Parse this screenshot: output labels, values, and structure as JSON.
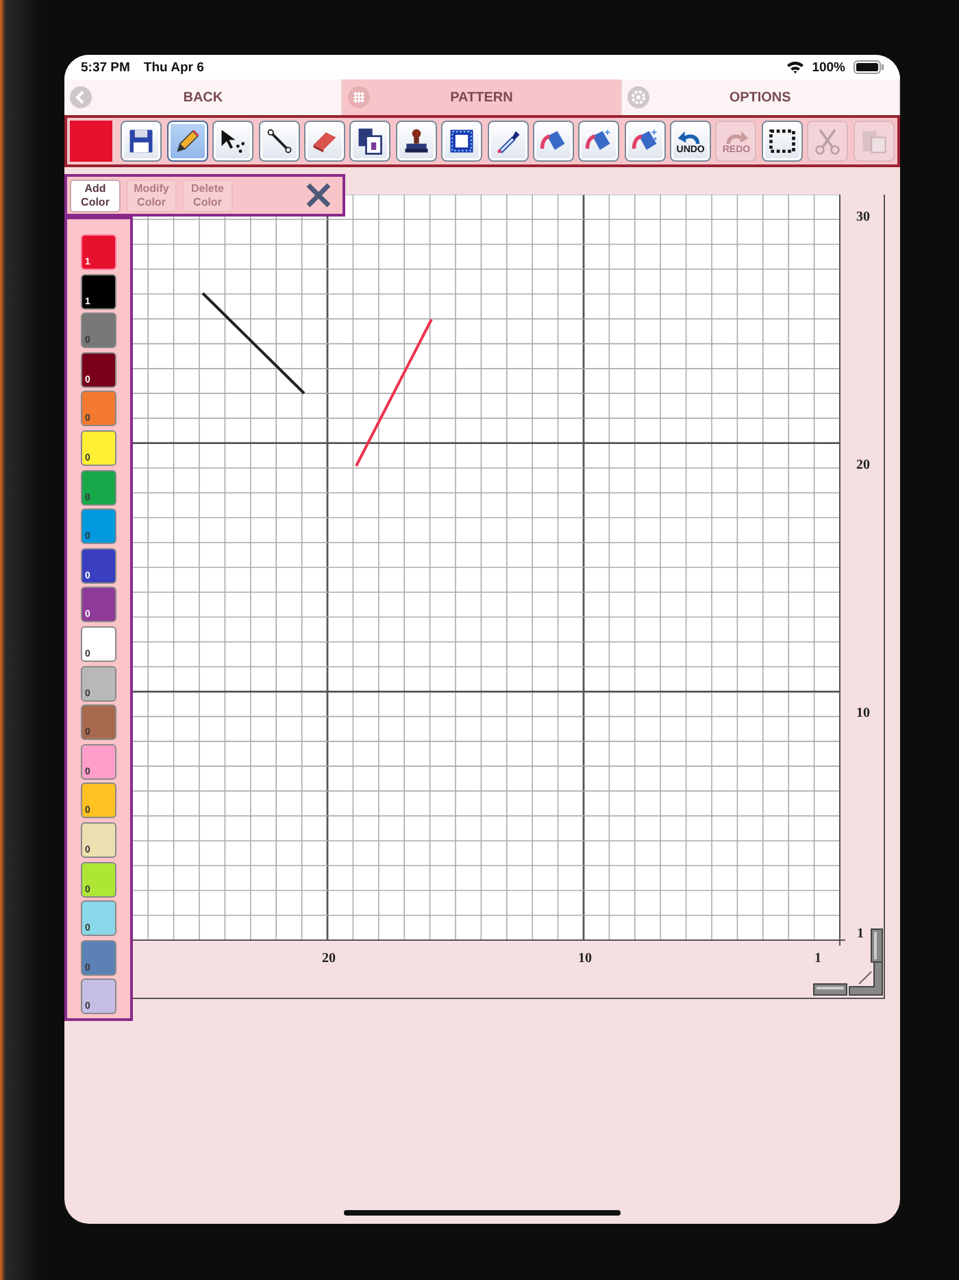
{
  "status_bar": {
    "time": "5:37 PM",
    "date": "Thu Apr 6",
    "battery": "100%"
  },
  "tabs": [
    {
      "label": "BACK",
      "kind": "back",
      "selected": false
    },
    {
      "label": "PATTERN",
      "kind": "grid",
      "selected": true
    },
    {
      "label": "OPTIONS",
      "kind": "gear",
      "selected": false
    }
  ],
  "toolbar": {
    "tools": [
      {
        "kind": "save",
        "selected": false,
        "disabled": false
      },
      {
        "kind": "pencil",
        "selected": true,
        "disabled": false
      },
      {
        "kind": "select",
        "selected": false,
        "disabled": false
      },
      {
        "kind": "line",
        "selected": false,
        "disabled": false
      },
      {
        "kind": "eraser",
        "selected": false,
        "disabled": false
      },
      {
        "kind": "copy",
        "selected": false,
        "disabled": false
      },
      {
        "kind": "stamp",
        "selected": false,
        "disabled": false
      },
      {
        "kind": "border",
        "selected": false,
        "disabled": false
      },
      {
        "kind": "dropper",
        "selected": false,
        "disabled": false
      },
      {
        "kind": "fill",
        "selected": false,
        "disabled": false
      },
      {
        "kind": "fill",
        "selected": false,
        "disabled": false
      },
      {
        "kind": "fill",
        "selected": false,
        "disabled": false
      },
      {
        "kind": "undo",
        "label": "UNDO",
        "selected": false,
        "disabled": false
      },
      {
        "kind": "redo",
        "label": "REDO",
        "selected": false,
        "disabled": true
      },
      {
        "kind": "marquee",
        "selected": false,
        "disabled": false
      },
      {
        "kind": "cut",
        "selected": false,
        "disabled": true
      },
      {
        "kind": "paste",
        "selected": false,
        "disabled": true
      }
    ]
  },
  "color_panel": {
    "buttons": [
      {
        "label": "Add Color",
        "disabled": false
      },
      {
        "label": "Modify Color",
        "disabled": true
      },
      {
        "label": "Delete Color",
        "disabled": true
      }
    ],
    "swatches": [
      {
        "color": "#e8112d",
        "count": "1",
        "selected": true
      },
      {
        "color": "#000000",
        "count": "1",
        "selected": false
      },
      {
        "color": "#777777",
        "count": "0",
        "selected": false
      },
      {
        "color": "#7a0019",
        "count": "0",
        "selected": false
      },
      {
        "color": "#f47a30",
        "count": "0",
        "selected": false
      },
      {
        "color": "#fff033",
        "count": "0",
        "selected": false
      },
      {
        "color": "#18a84a",
        "count": "0",
        "selected": false
      },
      {
        "color": "#0099e0",
        "count": "0",
        "selected": false
      },
      {
        "color": "#3a3ec0",
        "count": "0",
        "selected": false
      },
      {
        "color": "#8e3a98",
        "count": "0",
        "selected": false
      },
      {
        "color": "#ffffff",
        "count": "0",
        "selected": false
      },
      {
        "color": "#b8b8b8",
        "count": "0",
        "selected": false
      },
      {
        "color": "#a86a4f",
        "count": "0",
        "selected": false
      },
      {
        "color": "#ff9ec9",
        "count": "0",
        "selected": false
      },
      {
        "color": "#ffc222",
        "count": "0",
        "selected": false
      },
      {
        "color": "#ede0b0",
        "count": "0",
        "selected": false
      },
      {
        "color": "#aee635",
        "count": "0",
        "selected": false
      },
      {
        "color": "#8ad8ea",
        "count": "0",
        "selected": false
      },
      {
        "color": "#5c82b5",
        "count": "0",
        "selected": false
      },
      {
        "color": "#c5bde3",
        "count": "0",
        "selected": false
      }
    ]
  },
  "canvas": {
    "row_labels": [
      "30",
      "20",
      "10",
      "1"
    ],
    "column_labels": [
      "20",
      "10",
      "1"
    ],
    "stitches": [
      {
        "color": "#222222"
      },
      {
        "color": "#ee3350"
      }
    ]
  }
}
